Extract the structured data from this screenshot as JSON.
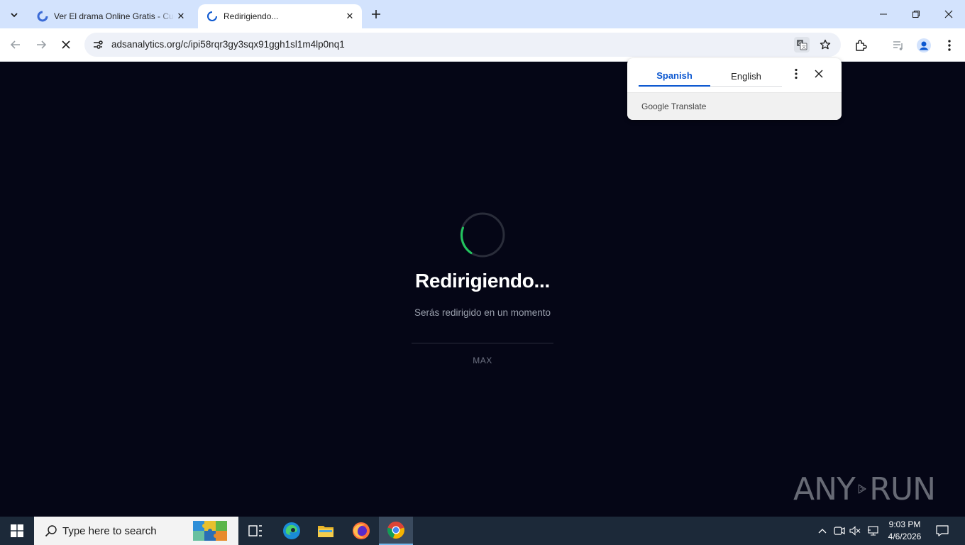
{
  "browser": {
    "tabs": [
      {
        "title": "Ver El drama Online Gratis - Cuevana",
        "active": false
      },
      {
        "title": "Redirigiendo...",
        "active": true
      }
    ],
    "address": "adsanalytics.org/c/ipi58rqr3gy3sqx91ggh1sl1m4lp0nq1"
  },
  "translate_popup": {
    "source_language": "Spanish",
    "target_language": "English",
    "footer": "Google Translate"
  },
  "page": {
    "heading": "Redirigiendo...",
    "subtitle": "Serás redirigido en un momento",
    "brand": "MAX"
  },
  "watermark": {
    "left": "ANY",
    "right": "RUN"
  },
  "taskbar": {
    "search_placeholder": "Type here to search",
    "time": "9:03 PM",
    "date": "4/6/2026"
  },
  "colors": {
    "tabstrip": "#d3e3fd",
    "page_bg": "#050616",
    "spinner_accent": "#22c55e",
    "translate_accent": "#0b57d0",
    "taskbar": "#1c2939"
  }
}
